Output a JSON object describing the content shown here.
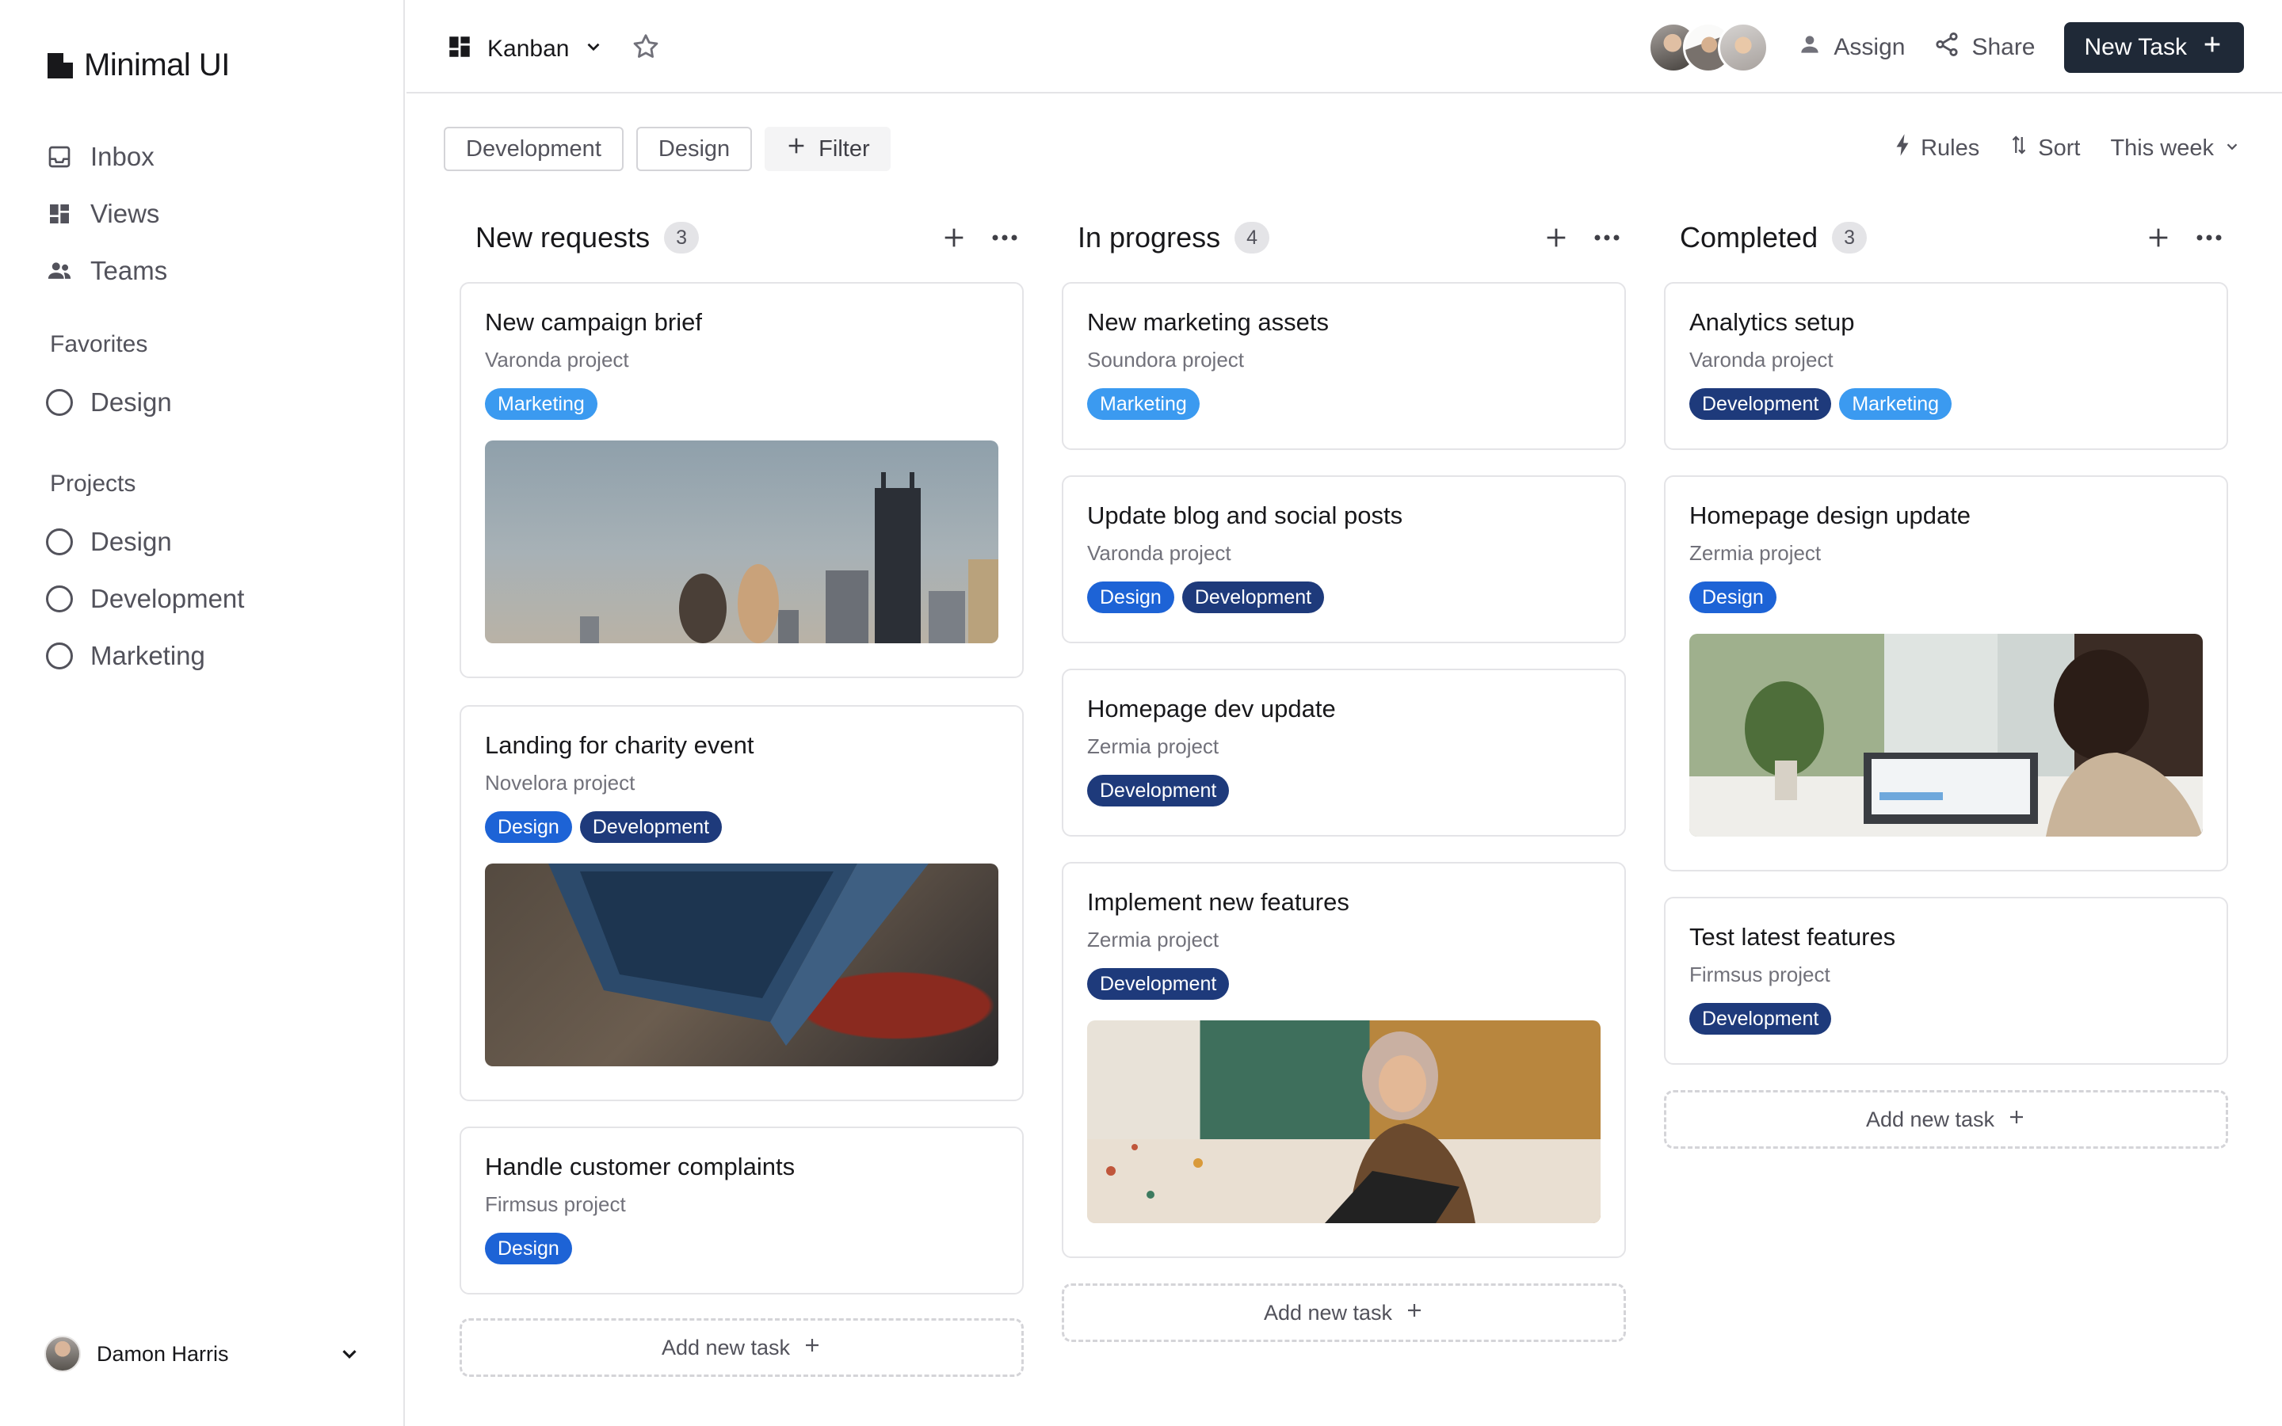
{
  "brand": {
    "name": "Minimal UI"
  },
  "sidebar": {
    "nav": [
      {
        "label": "Inbox",
        "icon": "inbox-icon"
      },
      {
        "label": "Views",
        "icon": "grid-icon"
      },
      {
        "label": "Teams",
        "icon": "people-icon"
      }
    ],
    "favorites_title": "Favorites",
    "favorites": [
      {
        "label": "Design"
      }
    ],
    "projects_title": "Projects",
    "projects": [
      {
        "label": "Design"
      },
      {
        "label": "Development"
      },
      {
        "label": "Marketing"
      }
    ],
    "user": {
      "name": "Damon Harris"
    }
  },
  "header": {
    "view_label": "Kanban",
    "assign_label": "Assign",
    "share_label": "Share",
    "new_task_label": "New Task"
  },
  "filters": {
    "chips": [
      "Development",
      "Design"
    ],
    "filter_label": "Filter",
    "rules_label": "Rules",
    "sort_label": "Sort",
    "period_label": "This week"
  },
  "colors": {
    "marketing": "#3b9af0",
    "design": "#1d63d6",
    "development": "#1e3a7b",
    "primary": "#1f2937"
  },
  "board": {
    "add_task_label": "Add new task",
    "columns": [
      {
        "title": "New requests",
        "count": "3",
        "cards": [
          {
            "title": "New campaign brief",
            "project": "Varonda project",
            "tags": [
              "Marketing"
            ],
            "image": "city-photo"
          },
          {
            "title": "Landing for charity event",
            "project": "Novelora project",
            "tags": [
              "Design",
              "Development"
            ],
            "image": "laptop-photo"
          },
          {
            "title": "Handle customer complaints",
            "project": "Firmsus project",
            "tags": [
              "Design"
            ]
          }
        ]
      },
      {
        "title": "In progress",
        "count": "4",
        "cards": [
          {
            "title": "New marketing assets",
            "project": "Soundora project",
            "tags": [
              "Marketing"
            ]
          },
          {
            "title": "Update blog and social posts",
            "project": "Varonda project",
            "tags": [
              "Design",
              "Development"
            ]
          },
          {
            "title": "Homepage dev update",
            "project": "Zermia project",
            "tags": [
              "Development"
            ]
          },
          {
            "title": "Implement new features",
            "project": "Zermia project",
            "tags": [
              "Development"
            ],
            "image": "video-call-photo"
          }
        ]
      },
      {
        "title": "Completed",
        "count": "3",
        "cards": [
          {
            "title": "Analytics setup",
            "project": "Varonda project",
            "tags": [
              "Development",
              "Marketing"
            ]
          },
          {
            "title": "Homepage design update",
            "project": "Zermia project",
            "tags": [
              "Design"
            ],
            "image": "office-photo"
          },
          {
            "title": "Test latest features",
            "project": "Firmsus project",
            "tags": [
              "Development"
            ]
          }
        ]
      }
    ]
  }
}
